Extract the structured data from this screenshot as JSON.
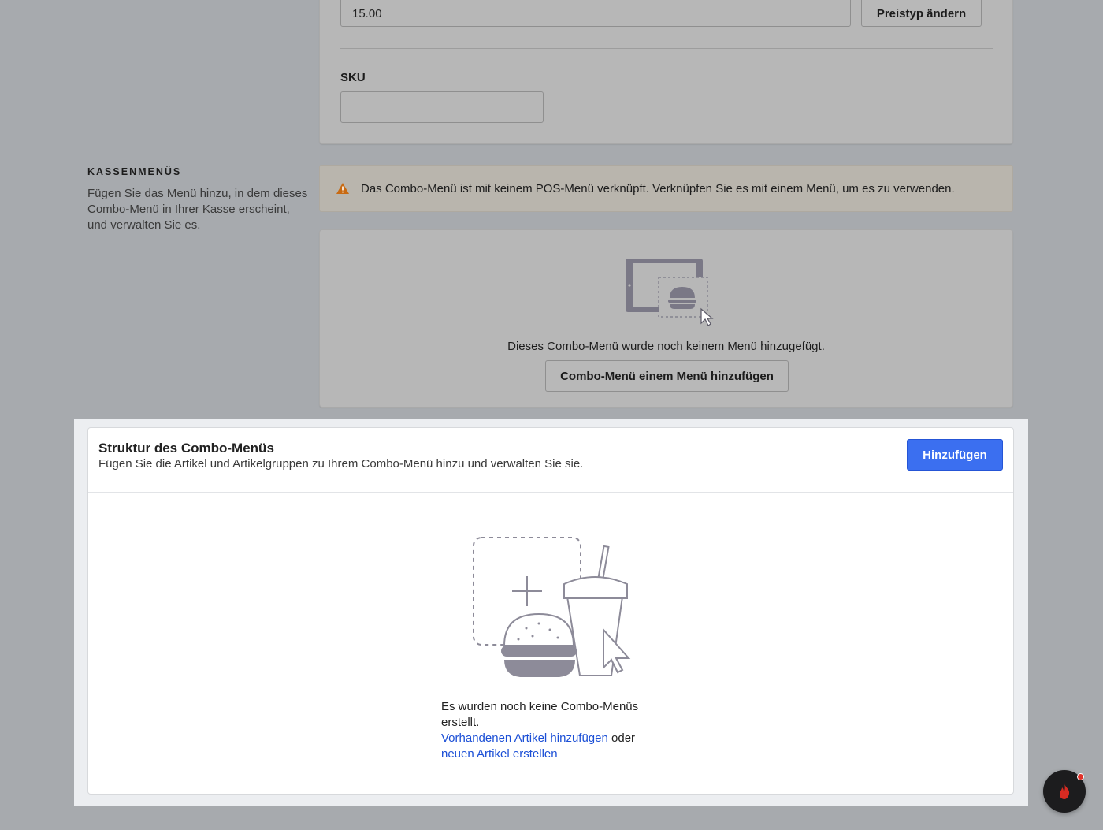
{
  "pricing": {
    "price_value": "15.00",
    "change_price_type_label": "Preistyp ändern",
    "sku_label": "SKU",
    "sku_value": ""
  },
  "pos_menus": {
    "heading": "KASSENMENÜS",
    "description": "Fügen Sie das Menü hinzu, in dem dieses Combo-Menü in Ihrer Kasse erscheint, und verwalten Sie es.",
    "warning_text": "Das Combo-Menü ist mit keinem POS-Menü verknüpft. Verknüpfen Sie es mit einem Menü, um es zu verwenden.",
    "empty_text": "Dieses Combo-Menü wurde noch keinem Menü hinzugefügt.",
    "add_to_menu_label": "Combo-Menü einem Menü hinzufügen"
  },
  "combo_structure": {
    "title": "Struktur des Combo-Menüs",
    "subtitle": "Fügen Sie die Artikel und Artikelgruppen zu Ihrem Combo-Menü hinzu und verwalten Sie sie.",
    "add_label": "Hinzufügen",
    "empty_text": "Es wurden noch keine Combo-Menüs erstellt.",
    "add_existing_link": "Vorhandenen Artikel hinzufügen",
    "or_text": "oder",
    "create_new_link": "neuen Artikel erstellen"
  },
  "icons": {
    "warning": "warning-triangle-icon",
    "pos_tablet": "tablet-burger-illustration",
    "combo_illustration": "burger-drink-illustration",
    "chat": "chat-flame-icon"
  },
  "colors": {
    "accent": "#3b6ff0",
    "link": "#1b4fd6",
    "warning": "#c86a12",
    "notification": "#e0322a"
  }
}
